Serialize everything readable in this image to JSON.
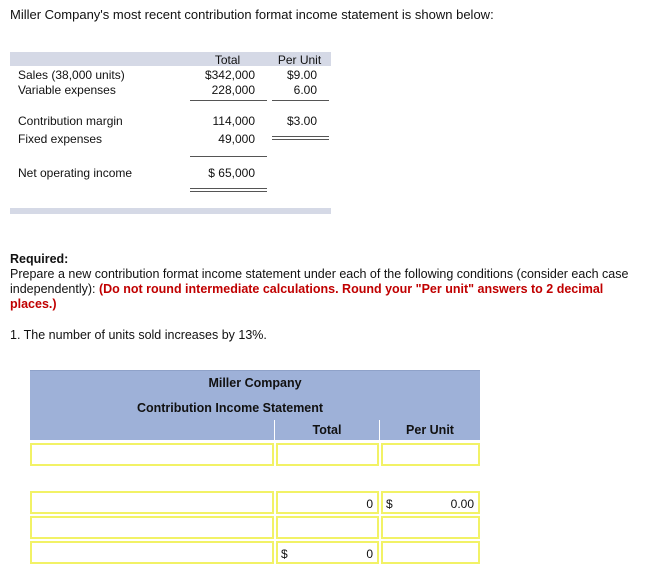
{
  "intro": "Miller Company's most recent contribution format income statement is shown below:",
  "statement": {
    "col_total": "Total",
    "col_per_unit": "Per Unit",
    "rows": [
      {
        "label": "Sales (38,000 units)",
        "total": "$342,000",
        "per_unit": "$9.00"
      },
      {
        "label": "Variable expenses",
        "total": "228,000",
        "per_unit": "6.00"
      },
      {
        "label": "Contribution margin",
        "total": "114,000",
        "per_unit": "$3.00"
      },
      {
        "label": "Fixed expenses",
        "total": "49,000",
        "per_unit": ""
      },
      {
        "label": "Net operating income",
        "total": "$ 65,000",
        "per_unit": ""
      }
    ]
  },
  "required": {
    "heading": "Required:",
    "text": "Prepare a new contribution format income statement under each of the following conditions (consider each case independently):",
    "instruction": "(Do not round intermediate calculations. Round your \"Per unit\" answers to 2 decimal places.)"
  },
  "question": "1. The number of units sold increases by 13%.",
  "answer_table": {
    "company": "Miller Company",
    "title": "Contribution Income Statement",
    "col_total": "Total",
    "col_per_unit": "Per Unit",
    "rows": [
      {
        "label": "",
        "cur_total": "",
        "total": "",
        "cur_unit": "",
        "per_unit": ""
      },
      {
        "label": "",
        "cur_total": "",
        "total": "0",
        "cur_unit": "$",
        "per_unit": "0.00"
      },
      {
        "label": "",
        "cur_total": "",
        "total": "",
        "cur_unit": "",
        "per_unit": ""
      },
      {
        "label": "",
        "cur_total": "$",
        "total": "0",
        "cur_unit": "",
        "per_unit": ""
      }
    ]
  }
}
